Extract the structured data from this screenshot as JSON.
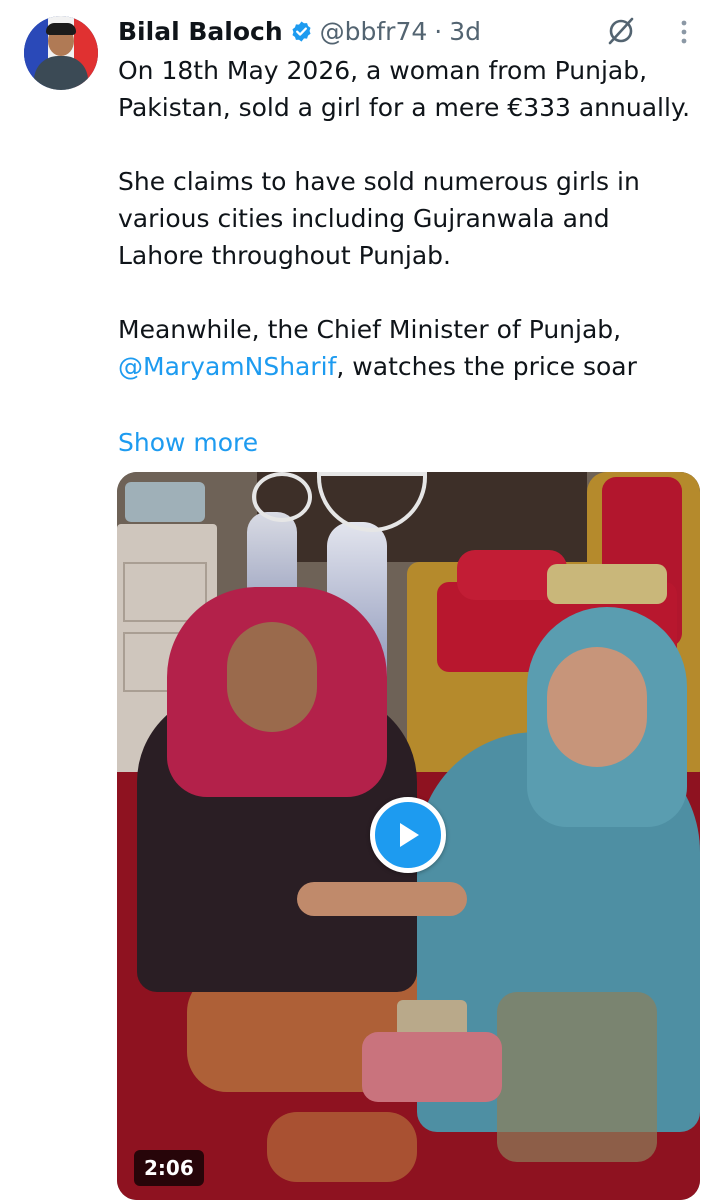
{
  "author": {
    "name": "Bilal Baloch",
    "handle": "@bbfr74",
    "separator": "·",
    "time": "3d",
    "verified": true,
    "avatar": "profile-photo-with-french-flag"
  },
  "icons": {
    "verified": "verified-badge-icon",
    "grok": "grok-icon",
    "more": "more-vertical-icon",
    "play": "play-icon"
  },
  "tweet": {
    "paragraph1": "On 18th May 2026, a woman from Punjab, Pakistan, sold a girl for a mere €333 annually.",
    "paragraph2": "She claims to have sold numerous girls in various cities including Gujranwala and Lahore throughout Punjab.",
    "paragraph3_before": "Meanwhile, the Chief Minister of Punjab, ",
    "mention": "@MaryamNSharif",
    "paragraph3_after": ", watches the price soar",
    "show_more": "Show more"
  },
  "media": {
    "type": "video",
    "duration": "2:06"
  },
  "colors": {
    "accent": "#1d9bf0",
    "text": "#0f1419",
    "secondary": "#536471"
  }
}
